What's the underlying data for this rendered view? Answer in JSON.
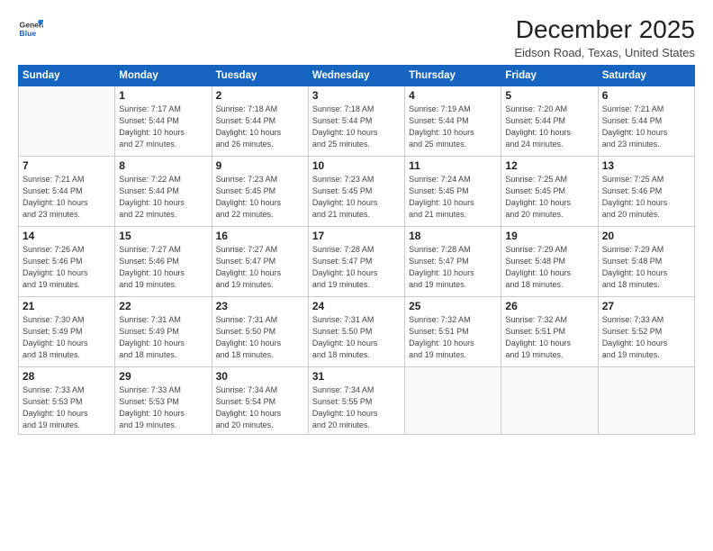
{
  "header": {
    "logo_general": "General",
    "logo_blue": "Blue",
    "title": "December 2025",
    "subtitle": "Eidson Road, Texas, United States"
  },
  "calendar": {
    "days_of_week": [
      "Sunday",
      "Monday",
      "Tuesday",
      "Wednesday",
      "Thursday",
      "Friday",
      "Saturday"
    ],
    "weeks": [
      [
        {
          "day": "",
          "info": ""
        },
        {
          "day": "1",
          "info": "Sunrise: 7:17 AM\nSunset: 5:44 PM\nDaylight: 10 hours\nand 27 minutes."
        },
        {
          "day": "2",
          "info": "Sunrise: 7:18 AM\nSunset: 5:44 PM\nDaylight: 10 hours\nand 26 minutes."
        },
        {
          "day": "3",
          "info": "Sunrise: 7:18 AM\nSunset: 5:44 PM\nDaylight: 10 hours\nand 25 minutes."
        },
        {
          "day": "4",
          "info": "Sunrise: 7:19 AM\nSunset: 5:44 PM\nDaylight: 10 hours\nand 25 minutes."
        },
        {
          "day": "5",
          "info": "Sunrise: 7:20 AM\nSunset: 5:44 PM\nDaylight: 10 hours\nand 24 minutes."
        },
        {
          "day": "6",
          "info": "Sunrise: 7:21 AM\nSunset: 5:44 PM\nDaylight: 10 hours\nand 23 minutes."
        }
      ],
      [
        {
          "day": "7",
          "info": "Sunrise: 7:21 AM\nSunset: 5:44 PM\nDaylight: 10 hours\nand 23 minutes."
        },
        {
          "day": "8",
          "info": "Sunrise: 7:22 AM\nSunset: 5:44 PM\nDaylight: 10 hours\nand 22 minutes."
        },
        {
          "day": "9",
          "info": "Sunrise: 7:23 AM\nSunset: 5:45 PM\nDaylight: 10 hours\nand 22 minutes."
        },
        {
          "day": "10",
          "info": "Sunrise: 7:23 AM\nSunset: 5:45 PM\nDaylight: 10 hours\nand 21 minutes."
        },
        {
          "day": "11",
          "info": "Sunrise: 7:24 AM\nSunset: 5:45 PM\nDaylight: 10 hours\nand 21 minutes."
        },
        {
          "day": "12",
          "info": "Sunrise: 7:25 AM\nSunset: 5:45 PM\nDaylight: 10 hours\nand 20 minutes."
        },
        {
          "day": "13",
          "info": "Sunrise: 7:25 AM\nSunset: 5:46 PM\nDaylight: 10 hours\nand 20 minutes."
        }
      ],
      [
        {
          "day": "14",
          "info": "Sunrise: 7:26 AM\nSunset: 5:46 PM\nDaylight: 10 hours\nand 19 minutes."
        },
        {
          "day": "15",
          "info": "Sunrise: 7:27 AM\nSunset: 5:46 PM\nDaylight: 10 hours\nand 19 minutes."
        },
        {
          "day": "16",
          "info": "Sunrise: 7:27 AM\nSunset: 5:47 PM\nDaylight: 10 hours\nand 19 minutes."
        },
        {
          "day": "17",
          "info": "Sunrise: 7:28 AM\nSunset: 5:47 PM\nDaylight: 10 hours\nand 19 minutes."
        },
        {
          "day": "18",
          "info": "Sunrise: 7:28 AM\nSunset: 5:47 PM\nDaylight: 10 hours\nand 19 minutes."
        },
        {
          "day": "19",
          "info": "Sunrise: 7:29 AM\nSunset: 5:48 PM\nDaylight: 10 hours\nand 18 minutes."
        },
        {
          "day": "20",
          "info": "Sunrise: 7:29 AM\nSunset: 5:48 PM\nDaylight: 10 hours\nand 18 minutes."
        }
      ],
      [
        {
          "day": "21",
          "info": "Sunrise: 7:30 AM\nSunset: 5:49 PM\nDaylight: 10 hours\nand 18 minutes."
        },
        {
          "day": "22",
          "info": "Sunrise: 7:31 AM\nSunset: 5:49 PM\nDaylight: 10 hours\nand 18 minutes."
        },
        {
          "day": "23",
          "info": "Sunrise: 7:31 AM\nSunset: 5:50 PM\nDaylight: 10 hours\nand 18 minutes."
        },
        {
          "day": "24",
          "info": "Sunrise: 7:31 AM\nSunset: 5:50 PM\nDaylight: 10 hours\nand 18 minutes."
        },
        {
          "day": "25",
          "info": "Sunrise: 7:32 AM\nSunset: 5:51 PM\nDaylight: 10 hours\nand 19 minutes."
        },
        {
          "day": "26",
          "info": "Sunrise: 7:32 AM\nSunset: 5:51 PM\nDaylight: 10 hours\nand 19 minutes."
        },
        {
          "day": "27",
          "info": "Sunrise: 7:33 AM\nSunset: 5:52 PM\nDaylight: 10 hours\nand 19 minutes."
        }
      ],
      [
        {
          "day": "28",
          "info": "Sunrise: 7:33 AM\nSunset: 5:53 PM\nDaylight: 10 hours\nand 19 minutes."
        },
        {
          "day": "29",
          "info": "Sunrise: 7:33 AM\nSunset: 5:53 PM\nDaylight: 10 hours\nand 19 minutes."
        },
        {
          "day": "30",
          "info": "Sunrise: 7:34 AM\nSunset: 5:54 PM\nDaylight: 10 hours\nand 20 minutes."
        },
        {
          "day": "31",
          "info": "Sunrise: 7:34 AM\nSunset: 5:55 PM\nDaylight: 10 hours\nand 20 minutes."
        },
        {
          "day": "",
          "info": ""
        },
        {
          "day": "",
          "info": ""
        },
        {
          "day": "",
          "info": ""
        }
      ]
    ]
  }
}
